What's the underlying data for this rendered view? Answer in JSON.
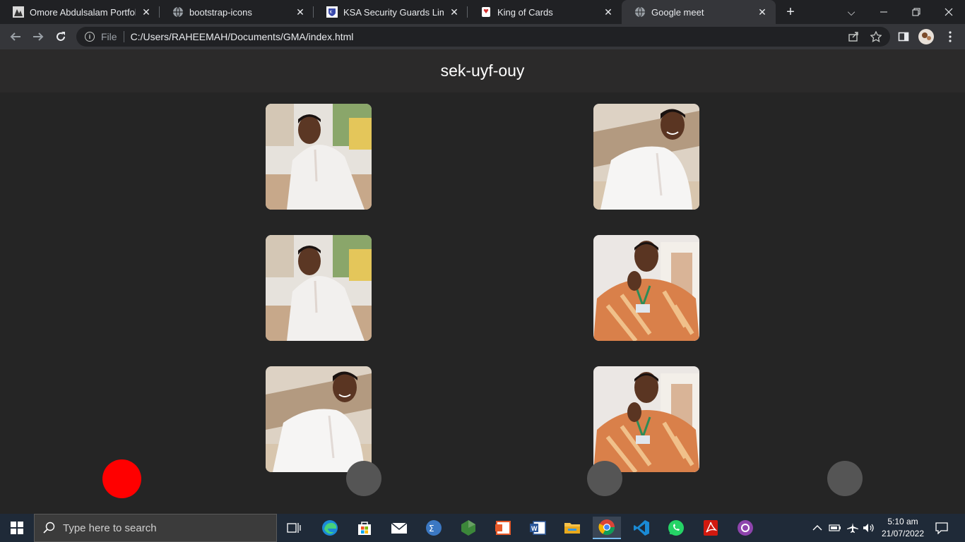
{
  "browser": {
    "tabs": [
      {
        "title": "Omore Abdulsalam Portfolio",
        "icon": "portfolio-favicon"
      },
      {
        "title": "bootstrap-icons",
        "icon": "globe-favicon"
      },
      {
        "title": "KSA Security Guards Limited",
        "icon": "ksa-favicon"
      },
      {
        "title": "King of Cards",
        "icon": "card-favicon"
      },
      {
        "title": "Google meet",
        "icon": "globe-favicon"
      }
    ],
    "active_tab": 4,
    "address": {
      "scheme_label": "File",
      "url": "C:/Users/RAHEEMAH/Documents/GMA/index.html"
    }
  },
  "page": {
    "meeting_code": "sek-uyf-ouy",
    "participants": [
      {
        "photo": "man-white-kaftan-outdoor"
      },
      {
        "photo": "man-white-kaftan-smiling"
      },
      {
        "photo": "man-white-kaftan-outdoor"
      },
      {
        "photo": "man-orange-shirt-lanyard"
      },
      {
        "photo": "man-white-kaftan-smiling"
      },
      {
        "photo": "man-orange-shirt-lanyard"
      }
    ],
    "controls": [
      {
        "name": "end-call",
        "color": "#ff0000"
      },
      {
        "name": "control-2",
        "color": "#555555"
      },
      {
        "name": "control-3",
        "color": "#555555"
      },
      {
        "name": "control-4",
        "color": "#555555"
      }
    ]
  },
  "taskbar": {
    "search_placeholder": "Type here to search",
    "apps": [
      "task-view",
      "edge",
      "store",
      "mail",
      "calculator",
      "node",
      "office",
      "word",
      "explorer",
      "chrome",
      "vscode",
      "whatsapp",
      "acrobat",
      "github"
    ],
    "active_app": "chrome",
    "clock": {
      "time": "5:10 am",
      "date": "21/07/2022"
    }
  }
}
